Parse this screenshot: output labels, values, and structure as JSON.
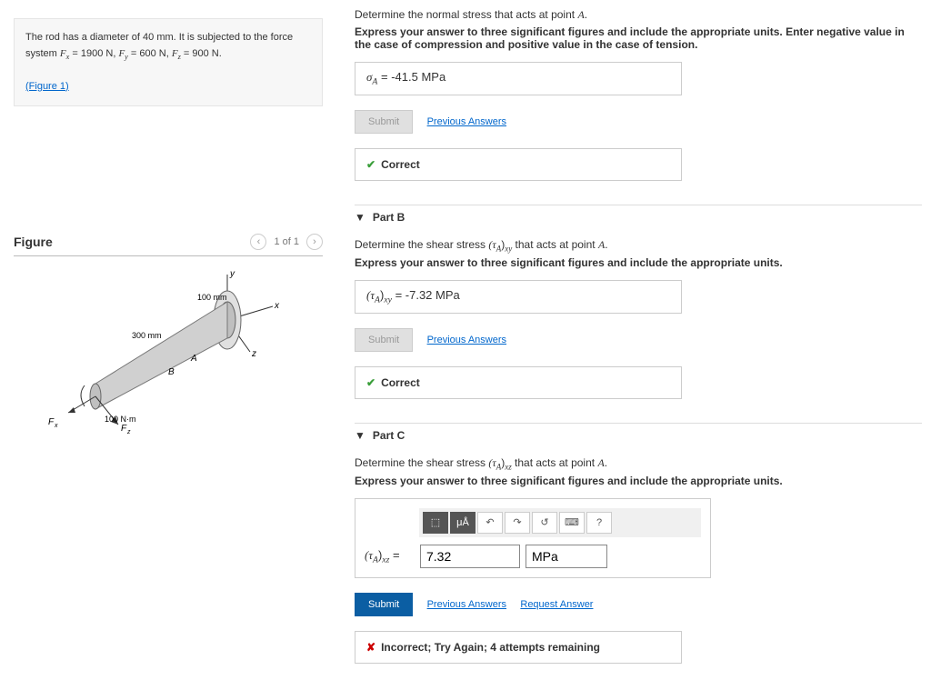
{
  "problem": {
    "text_pre": "The rod has a diameter of 40 ",
    "text_unit": "mm",
    "text_post": ". It is subjected to the force system ",
    "fx_label": "F",
    "fx_sub": "x",
    "fx_eq": " = 1900 N, ",
    "fy_label": "F",
    "fy_sub": "y",
    "fy_eq": " = 600 N, ",
    "fz_label": "F",
    "fz_sub": "z",
    "fz_eq": " = 900 N.",
    "figure_link": "(Figure 1)"
  },
  "partA": {
    "question": "Determine the normal stress that acts at point ",
    "point": "A",
    "instructions": "Express your answer to three significant figures and include the appropriate units. Enter negative value in the case of compression and positive value in the case of tension.",
    "answer_sym": "σ",
    "answer_sub": "A",
    "answer_val": " =  -41.5 MPa",
    "submit": "Submit",
    "prev": "Previous Answers",
    "feedback": "Correct"
  },
  "partB": {
    "title": "Part B",
    "question_pre": "Determine the shear stress ",
    "question_post": " that acts at point ",
    "point": "A",
    "sym": "(τ",
    "sub": "A",
    "dir": "xy",
    "instructions": "Express your answer to three significant figures and include the appropriate units.",
    "answer_val": " =  -7.32 MPa",
    "submit": "Submit",
    "prev": "Previous Answers",
    "feedback": "Correct"
  },
  "partC": {
    "title": "Part C",
    "question_pre": "Determine the shear stress ",
    "question_post": " that acts at point ",
    "point": "A",
    "sym": "(τ",
    "sub": "A",
    "dir": "xz",
    "instructions": "Express your answer to three significant figures and include the appropriate units.",
    "label": "(τ",
    "label_sub": "A",
    "label_dir": "xz",
    "label_eq": " = ",
    "value": "7.32",
    "unit": "MPa",
    "submit": "Submit",
    "prev": "Previous Answers",
    "request": "Request Answer",
    "feedback": "Incorrect; Try Again; 4 attempts remaining"
  },
  "figure": {
    "title": "Figure",
    "nav": "1 of 1",
    "labels": {
      "y": "y",
      "x": "x",
      "z": "z",
      "A": "A",
      "B": "B",
      "d1": "100 mm",
      "d2": "300 mm",
      "m": "100 N·m",
      "fx": "F",
      "fxs": "x",
      "fz": "F",
      "fzs": "z"
    }
  },
  "toolbar": {
    "t1": "⬚",
    "t2": "μÅ",
    "t3": "↶",
    "t4": "↷",
    "t5": "↺",
    "t6": "⌨",
    "t7": "?"
  }
}
